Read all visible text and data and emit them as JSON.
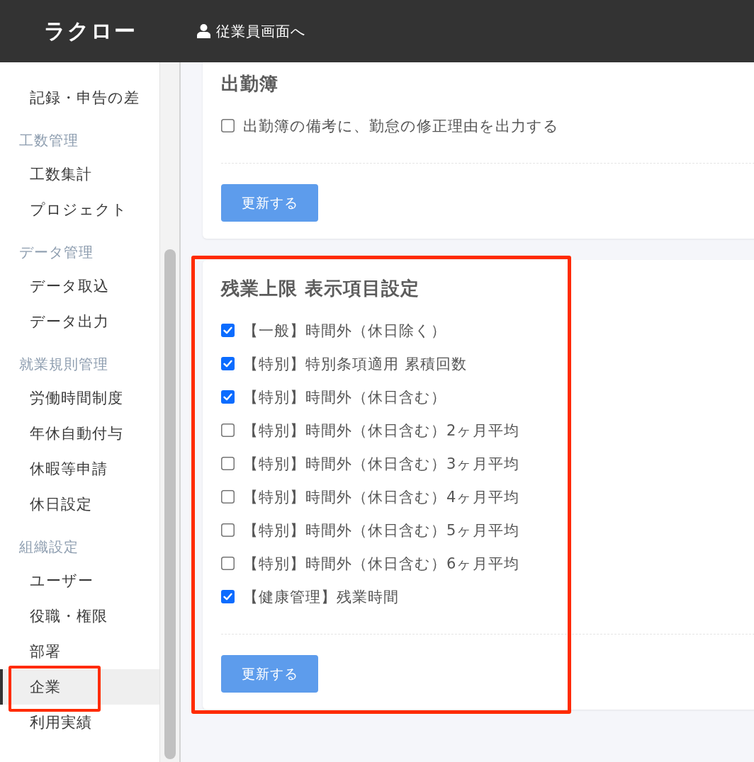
{
  "header": {
    "logo": "ラクロー",
    "employee_link": "従業員画面へ"
  },
  "sidebar": {
    "groups": [
      {
        "items": [
          {
            "label": "記録・申告の差",
            "selected": false,
            "highlighted": false
          }
        ]
      },
      {
        "heading": "工数管理",
        "items": [
          {
            "label": "工数集計",
            "selected": false,
            "highlighted": false
          },
          {
            "label": "プロジェクト",
            "selected": false,
            "highlighted": false
          }
        ]
      },
      {
        "heading": "データ管理",
        "items": [
          {
            "label": "データ取込",
            "selected": false,
            "highlighted": false
          },
          {
            "label": "データ出力",
            "selected": false,
            "highlighted": false
          }
        ]
      },
      {
        "heading": "就業規則管理",
        "items": [
          {
            "label": "労働時間制度",
            "selected": false,
            "highlighted": false
          },
          {
            "label": "年休自動付与",
            "selected": false,
            "highlighted": false
          },
          {
            "label": "休暇等申請",
            "selected": false,
            "highlighted": false
          },
          {
            "label": "休日設定",
            "selected": false,
            "highlighted": false
          }
        ]
      },
      {
        "heading": "組織設定",
        "items": [
          {
            "label": "ユーザー",
            "selected": false,
            "highlighted": false
          },
          {
            "label": "役職・権限",
            "selected": false,
            "highlighted": false
          },
          {
            "label": "部署",
            "selected": false,
            "highlighted": false
          },
          {
            "label": "企業",
            "selected": true,
            "highlighted": true
          },
          {
            "label": "利用実績",
            "selected": false,
            "highlighted": false
          }
        ]
      }
    ]
  },
  "cards": [
    {
      "title": "出勤簿",
      "highlighted": false,
      "options": [
        {
          "label": "出勤簿の備考に、勤怠の修正理由を出力する",
          "checked": false
        }
      ],
      "button": "更新する"
    },
    {
      "title": "残業上限 表示項目設定",
      "highlighted": true,
      "options": [
        {
          "label": "【一般】時間外（休日除く）",
          "checked": true
        },
        {
          "label": "【特別】特別条項適用 累積回数",
          "checked": true
        },
        {
          "label": "【特別】時間外（休日含む）",
          "checked": true
        },
        {
          "label": "【特別】時間外（休日含む）2ヶ月平均",
          "checked": false
        },
        {
          "label": "【特別】時間外（休日含む）3ヶ月平均",
          "checked": false
        },
        {
          "label": "【特別】時間外（休日含む）4ヶ月平均",
          "checked": false
        },
        {
          "label": "【特別】時間外（休日含む）5ヶ月平均",
          "checked": false
        },
        {
          "label": "【特別】時間外（休日含む）6ヶ月平均",
          "checked": false
        },
        {
          "label": "【健康管理】残業時間",
          "checked": true
        }
      ],
      "button": "更新する"
    }
  ]
}
